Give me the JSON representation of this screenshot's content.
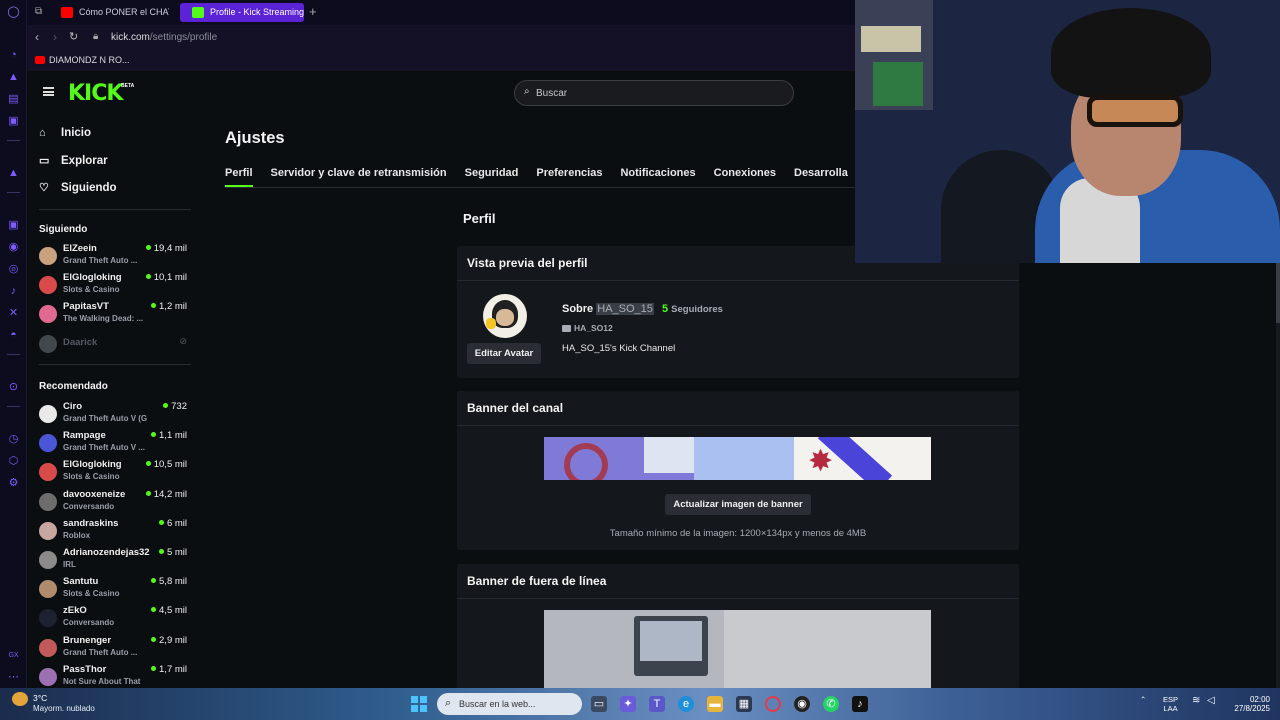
{
  "browser": {
    "tabs": [
      {
        "label": "Cómo PONER el CHAT de",
        "favicon_color": "#ff0000",
        "active": false
      },
      {
        "label": "Profile - Kick Streaming",
        "favicon_color": "#53fc18",
        "active": true
      }
    ],
    "url_host": "kick.com",
    "url_path": "/settings/profile",
    "bookmark": "DIAMONDZ N RO..."
  },
  "header": {
    "logo": "KICK",
    "beta": "BETA",
    "search_placeholder": "Buscar"
  },
  "sidebar": {
    "nav": [
      {
        "label": "Inicio",
        "icon": "home-icon"
      },
      {
        "label": "Explorar",
        "icon": "explore-icon"
      },
      {
        "label": "Siguiendo",
        "icon": "heart-icon"
      }
    ],
    "following_title": "Siguiendo",
    "following": [
      {
        "name": "ElZeein",
        "category": "Grand Theft Auto ...",
        "viewers": "19,4 mil",
        "color": "#c9a27e"
      },
      {
        "name": "ElGlogloking",
        "category": "Slots & Casino",
        "viewers": "10,1 mil",
        "color": "#d94b4b"
      },
      {
        "name": "PapitasVT",
        "category": "The Walking Dead: ...",
        "viewers": "1,2 mil",
        "color": "#e06a8f"
      },
      {
        "name": "Daarick",
        "category": "",
        "viewers": "",
        "color": "#7a7f88"
      }
    ],
    "recommended_title": "Recomendado",
    "recommended": [
      {
        "name": "Ciro",
        "category": "Grand Theft Auto V (G...",
        "viewers": "732",
        "color": "#e9e9e9"
      },
      {
        "name": "Rampage",
        "category": "Grand Theft Auto V ...",
        "viewers": "1,1 mil",
        "color": "#4b56d6"
      },
      {
        "name": "ElGlogloking",
        "category": "Slots & Casino",
        "viewers": "10,5 mil",
        "color": "#d94b4b"
      },
      {
        "name": "davooxeneize",
        "category": "Conversando",
        "viewers": "14,2 mil",
        "color": "#6d6d6d"
      },
      {
        "name": "sandraskins",
        "category": "Roblox",
        "viewers": "6 mil",
        "color": "#c8a7a0"
      },
      {
        "name": "Adrianozendejas32",
        "category": "IRL",
        "viewers": "5 mil",
        "color": "#8a8a8a"
      },
      {
        "name": "Santutu",
        "category": "Slots & Casino",
        "viewers": "5,8 mil",
        "color": "#b08a6c"
      },
      {
        "name": "zEkO",
        "category": "Conversando",
        "viewers": "4,5 mil",
        "color": "#1e2230"
      },
      {
        "name": "Brunenger",
        "category": "Grand Theft Auto ...",
        "viewers": "2,9 mil",
        "color": "#c25a5a"
      },
      {
        "name": "PassThor",
        "category": "Not Sure About That",
        "viewers": "1,7 mil",
        "color": "#9d6fb3"
      }
    ]
  },
  "settings": {
    "title": "Ajustes",
    "tabs": [
      "Perfil",
      "Servidor y clave de retransmisión",
      "Seguridad",
      "Preferencias",
      "Notificaciones",
      "Conexiones",
      "Desarrolla"
    ],
    "section": "Perfil"
  },
  "profile_card": {
    "title": "Vista previa del perfil",
    "about": "Sobre",
    "username": "HA_SO_15",
    "followers_count": "5",
    "followers_label": "Seguidores",
    "youtube": "HA_SO12",
    "bio": "HA_SO_15's Kick Channel",
    "edit_avatar": "Editar Avatar"
  },
  "banner_card": {
    "title": "Banner del canal",
    "update_button": "Actualizar imagen de banner",
    "note": "Tamaño mínimo de la imagen: 1200×134px y menos de 4MB"
  },
  "offline_card": {
    "title": "Banner de fuera de línea"
  },
  "taskbar": {
    "weather_temp": "3°C",
    "weather_desc": "Mayorm. nublado",
    "search": "Buscar en la web...",
    "lang1": "ESP",
    "lang2": "LAA",
    "time": "02:00",
    "date": "27/8/2025"
  }
}
